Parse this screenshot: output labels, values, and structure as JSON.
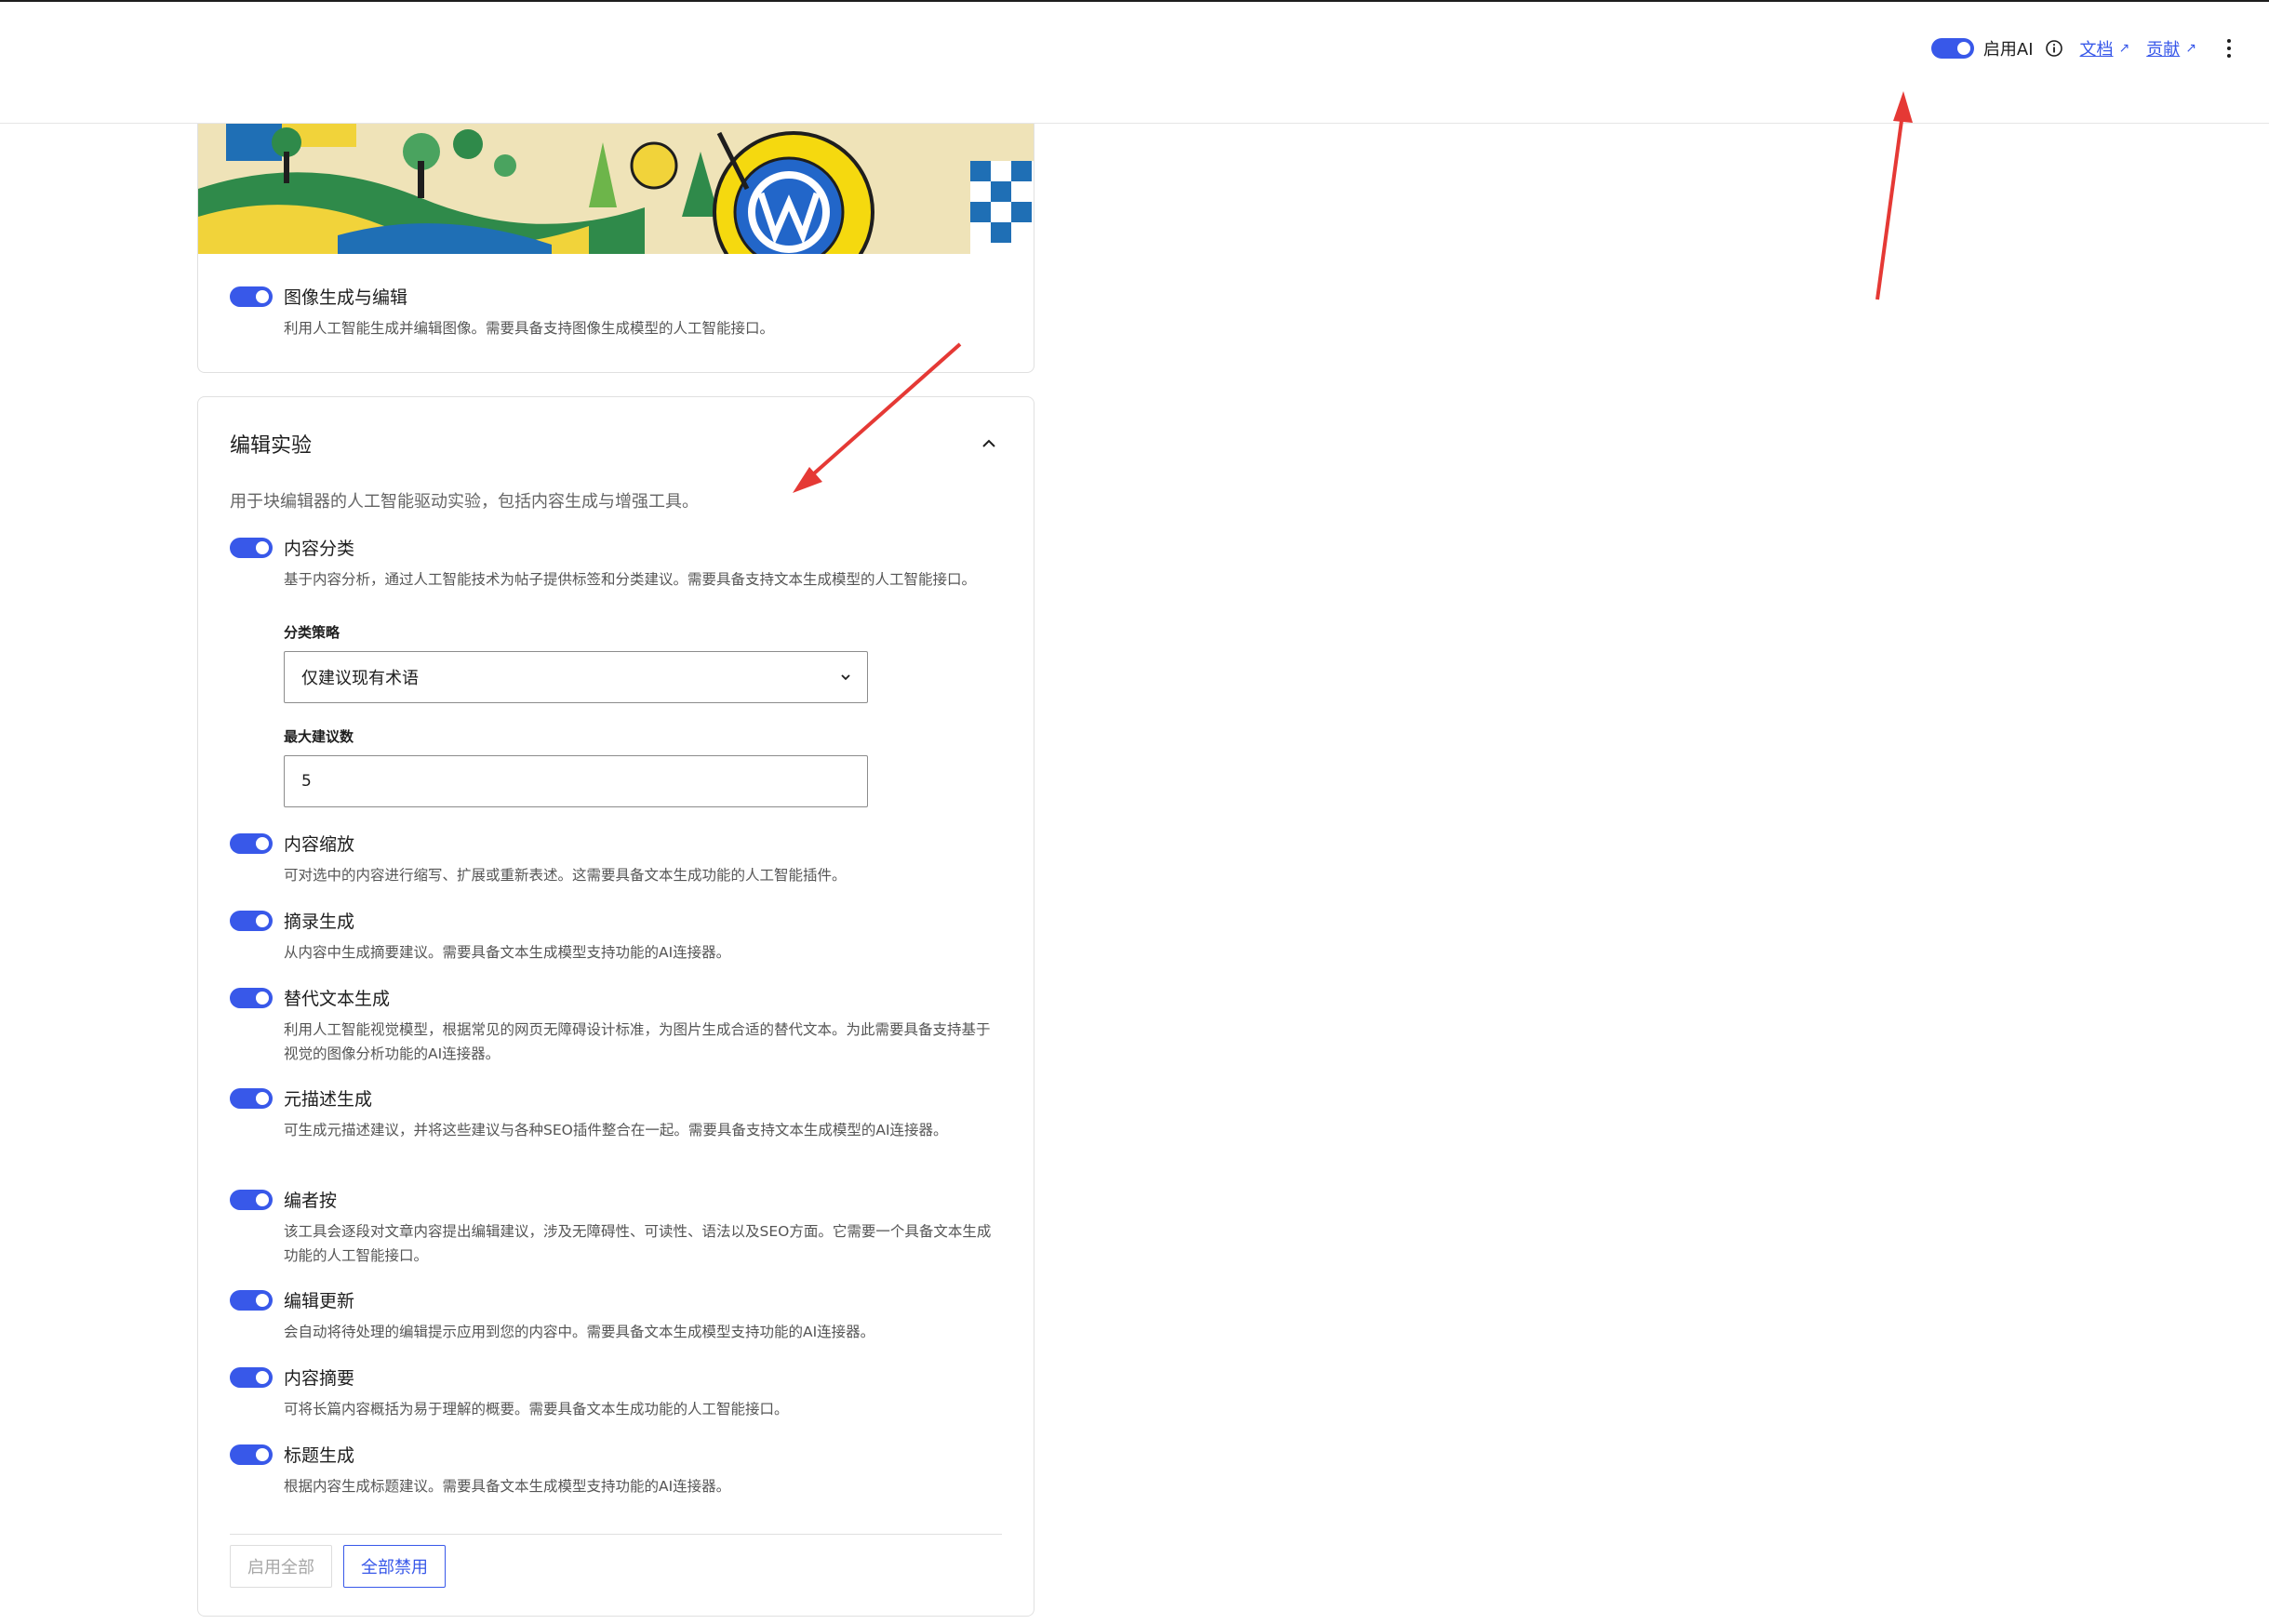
{
  "header": {
    "ai_toggle_label": "启用AI",
    "docs_link": "文档",
    "contribute_link": "贡献",
    "external_glyph": "↗"
  },
  "image_card": {
    "feature": {
      "title": "图像生成与编辑",
      "description": "利用人工智能生成并编辑图像。需要具备支持图像生成模型的人工智能接口。",
      "enabled": true
    }
  },
  "editor_card": {
    "title": "编辑实验",
    "intro": "用于块编辑器的人工智能驱动实验，包括内容生成与增强工具。",
    "features": [
      {
        "title": "内容分类",
        "description": "基于内容分析，通过人工智能技术为帖子提供标签和分类建议。需要具备支持文本生成模型的人工智能接口。",
        "enabled": true
      },
      {
        "title": "内容缩放",
        "description": "可对选中的内容进行缩写、扩展或重新表述。这需要具备文本生成功能的人工智能插件。",
        "enabled": true
      },
      {
        "title": "摘录生成",
        "description": "从内容中生成摘要建议。需要具备文本生成模型支持功能的AI连接器。",
        "enabled": true
      },
      {
        "title": "替代文本生成",
        "description": "利用人工智能视觉模型，根据常见的网页无障碍设计标准，为图片生成合适的替代文本。为此需要具备支持基于视觉的图像分析功能的AI连接器。",
        "enabled": true
      },
      {
        "title": "元描述生成",
        "description": "可生成元描述建议，并将这些建议与各种SEO插件整合在一起。需要具备支持文本生成模型的AI连接器。",
        "enabled": true
      },
      {
        "title": "编者按",
        "description": "该工具会逐段对文章内容提出编辑建议，涉及无障碍性、可读性、语法以及SEO方面。它需要一个具备文本生成功能的人工智能接口。",
        "enabled": true
      },
      {
        "title": "编辑更新",
        "description": "会自动将待处理的编辑提示应用到您的内容中。需要具备文本生成模型支持功能的AI连接器。",
        "enabled": true
      },
      {
        "title": "内容摘要",
        "description": "可将长篇内容概括为易于理解的概要。需要具备文本生成功能的人工智能接口。",
        "enabled": true
      },
      {
        "title": "标题生成",
        "description": "根据内容生成标题建议。需要具备文本生成模型支持功能的AI连接器。",
        "enabled": true
      }
    ],
    "strategy_label": "分类策略",
    "strategy_value": "仅建议现有术语",
    "max_label": "最大建议数",
    "max_value": "5",
    "enable_all": "启用全部",
    "disable_all": "全部禁用"
  },
  "colors": {
    "accent": "#3858e9",
    "annotation_arrow": "#e53935"
  }
}
